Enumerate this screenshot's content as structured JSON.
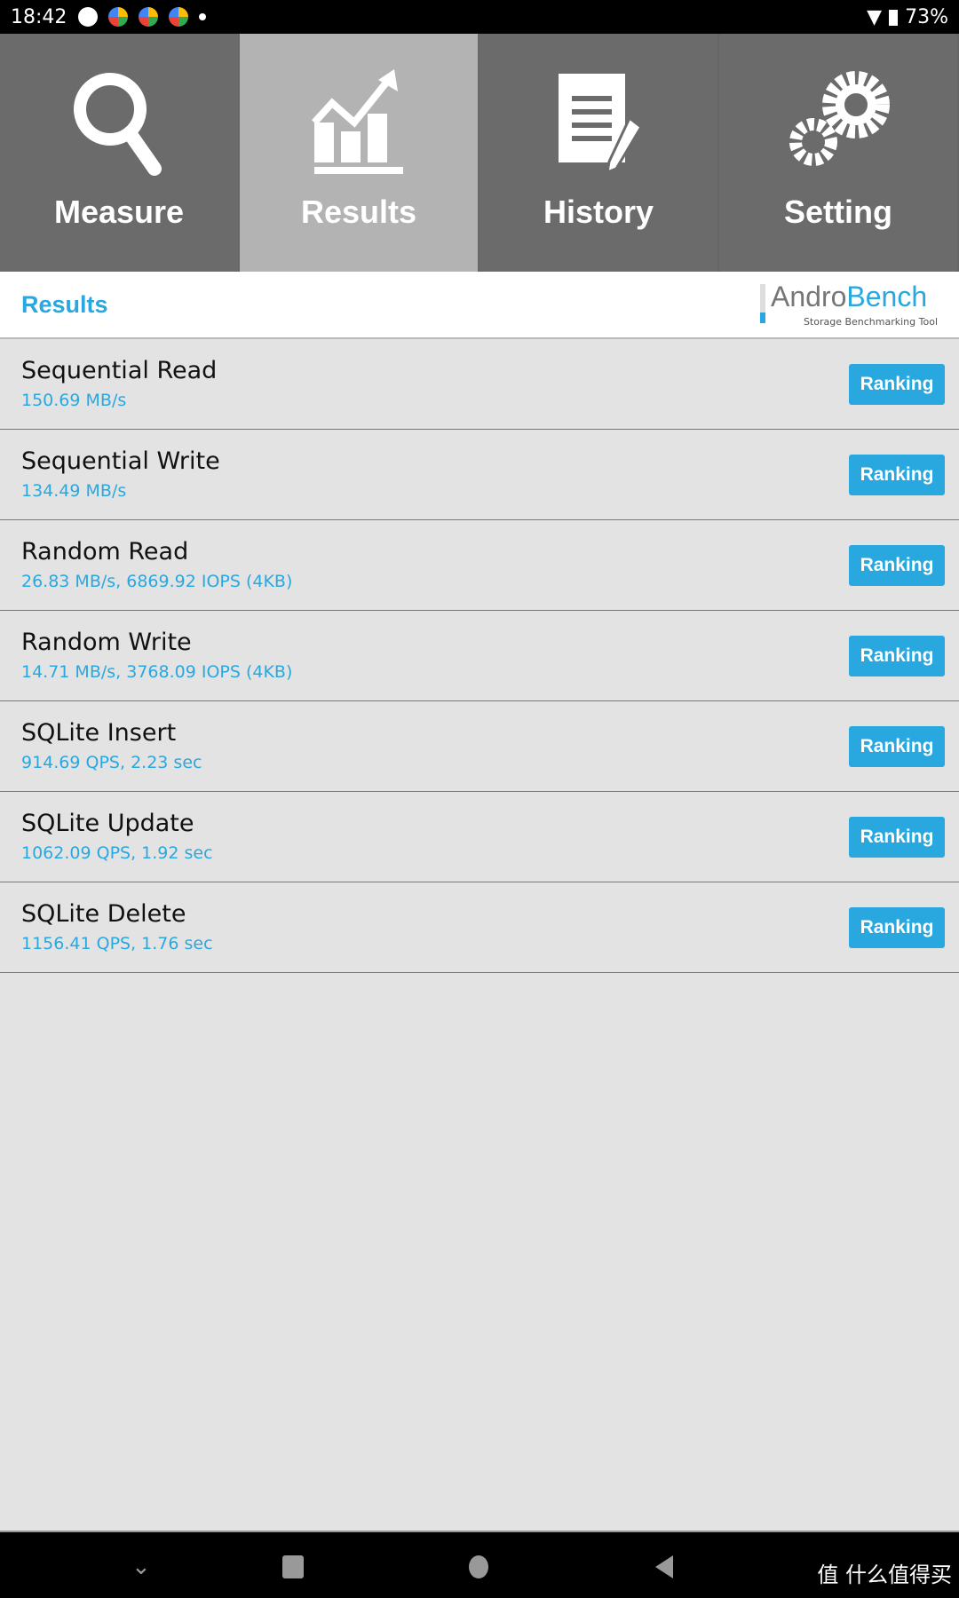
{
  "status_bar": {
    "time": "18:42",
    "battery": "73%"
  },
  "tabs": [
    {
      "label": "Measure",
      "icon": "search-icon"
    },
    {
      "label": "Results",
      "icon": "chart-icon",
      "active": true
    },
    {
      "label": "History",
      "icon": "document-icon"
    },
    {
      "label": "Setting",
      "icon": "gear-icon"
    }
  ],
  "header": {
    "title": "Results",
    "logo_a": "Andro",
    "logo_b": "Bench",
    "logo_tagline": "Storage Benchmarking Tool"
  },
  "results": [
    {
      "name": "Sequential Read",
      "value": "150.69 MB/s",
      "button": "Ranking"
    },
    {
      "name": "Sequential Write",
      "value": "134.49 MB/s",
      "button": "Ranking"
    },
    {
      "name": "Random Read",
      "value": "26.83 MB/s, 6869.92 IOPS (4KB)",
      "button": "Ranking"
    },
    {
      "name": "Random Write",
      "value": "14.71 MB/s, 3768.09 IOPS (4KB)",
      "button": "Ranking"
    },
    {
      "name": "SQLite Insert",
      "value": "914.69 QPS, 2.23 sec",
      "button": "Ranking"
    },
    {
      "name": "SQLite Update",
      "value": "1062.09 QPS, 1.92 sec",
      "button": "Ranking"
    },
    {
      "name": "SQLite Delete",
      "value": "1156.41 QPS, 1.76 sec",
      "button": "Ranking"
    }
  ],
  "watermark": "值 什么值得买",
  "colors": {
    "accent": "#29a8e0",
    "tab_bg": "#6b6b6b",
    "tab_active": "#b3b3b3"
  }
}
